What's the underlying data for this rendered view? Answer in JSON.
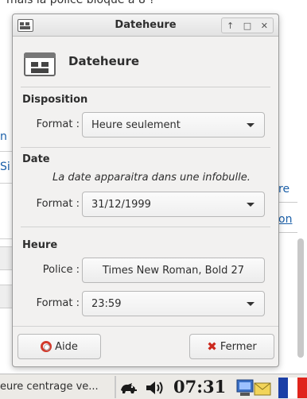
{
  "background": {
    "top_text": "mais la police bloque à 8 ?",
    "left_fragments": [
      "n",
      "Si"
    ],
    "right_links": [
      "re",
      "on"
    ]
  },
  "dialog": {
    "title": "Dateheure",
    "header_title": "Dateheure",
    "window_buttons": {
      "up": "↑",
      "restore": "□",
      "close": "✕"
    },
    "disposition": {
      "heading": "Disposition",
      "format_label": "Format :",
      "format_value": "Heure seulement"
    },
    "date": {
      "heading": "Date",
      "note": "La date apparaitra dans une infobulle.",
      "format_label": "Format :",
      "format_value": "31/12/1999"
    },
    "heure": {
      "heading": "Heure",
      "police_label": "Police :",
      "police_value": "Times New Roman, Bold 27",
      "format_label": "Format :",
      "format_value": "23:59"
    },
    "buttons": {
      "help": "Aide",
      "close": "Fermer"
    }
  },
  "taskbar": {
    "task_label": "eure centrage ve...",
    "clock": "07:31",
    "flag_colors": [
      "#1b3fa6",
      "#ffffff",
      "#e0241c"
    ]
  }
}
